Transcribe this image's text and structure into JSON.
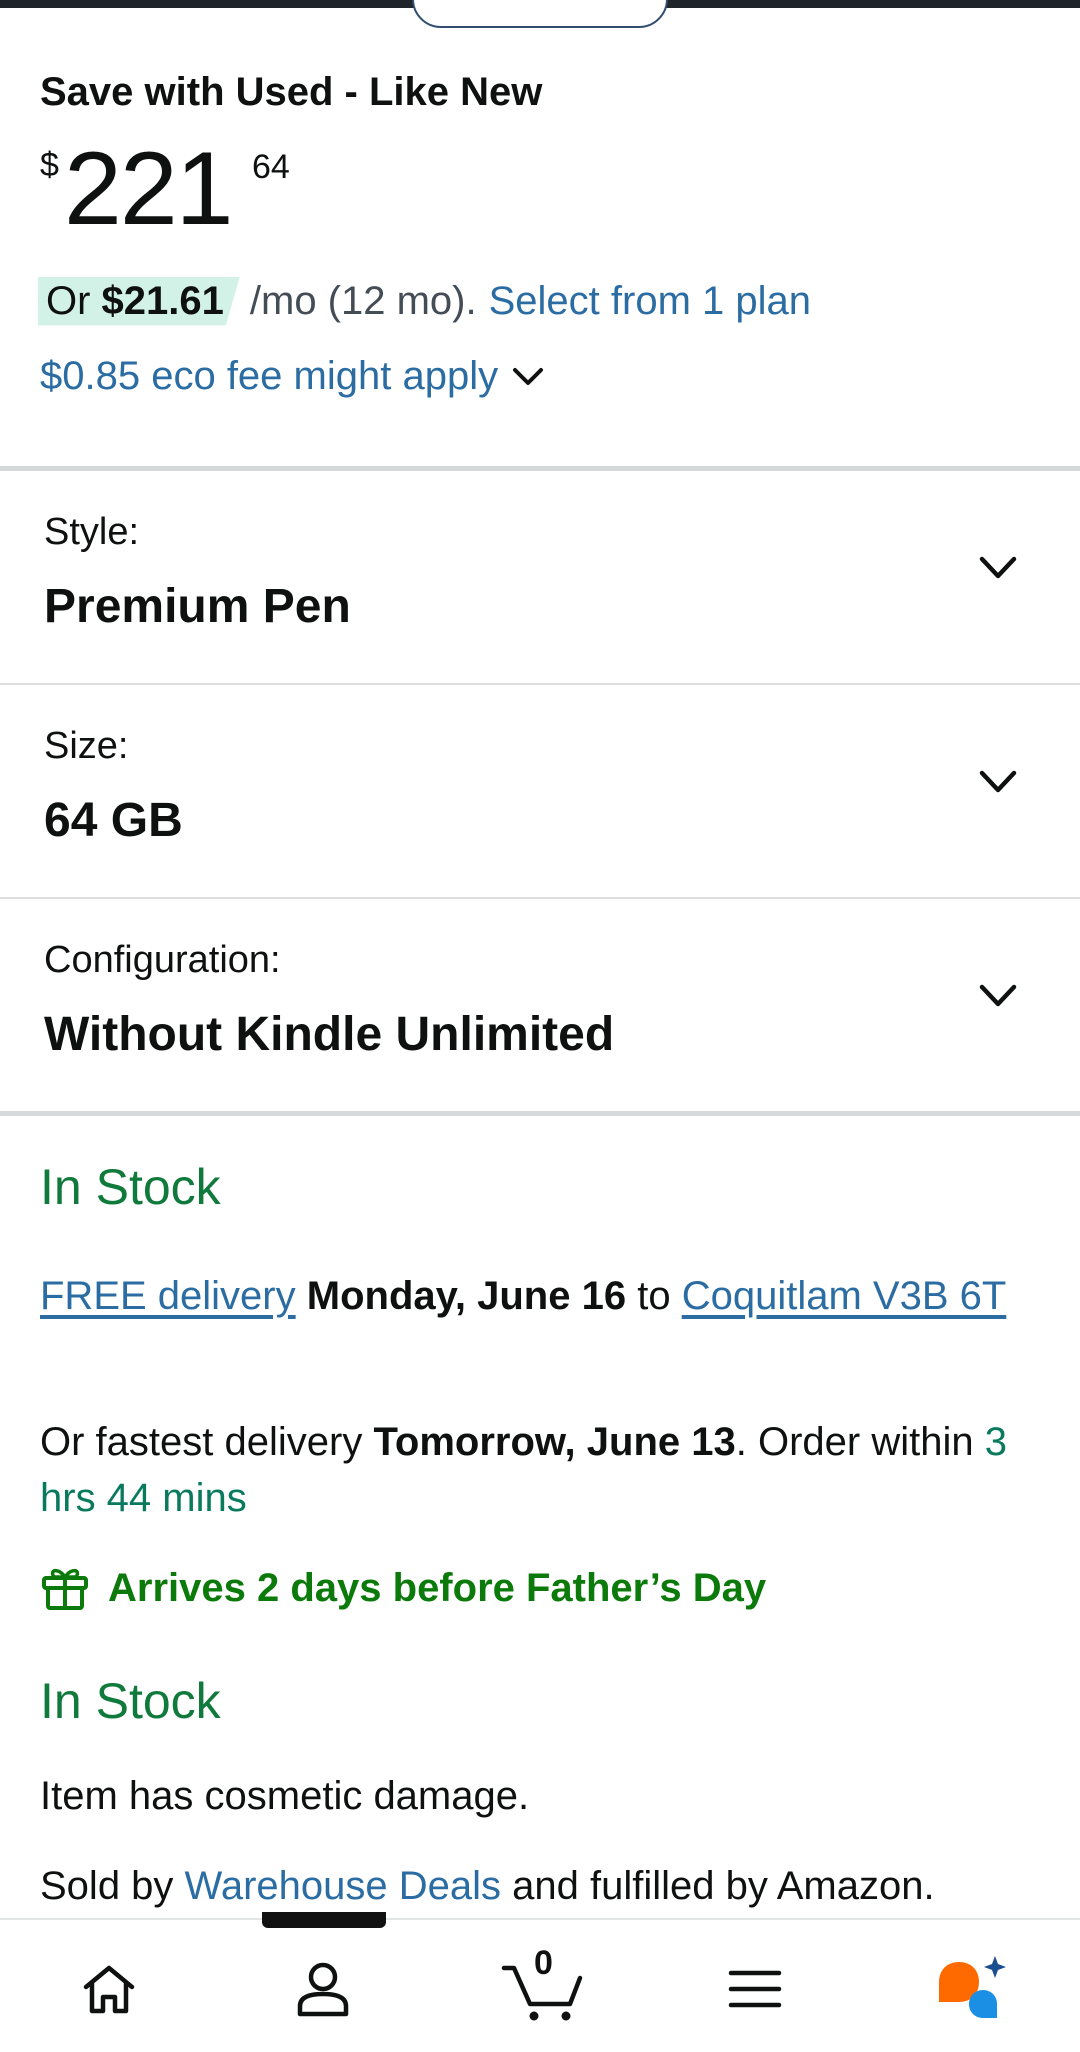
{
  "offer": {
    "title": "Save with Used - Like New",
    "price_currency": "$",
    "price_whole": "221",
    "price_fraction": "64"
  },
  "installment": {
    "prefix": "Or ",
    "amount": "$21.61",
    "term": "/mo (12 mo).",
    "plan_link": "Select from 1 plan"
  },
  "eco_fee": {
    "label": "$0.85 eco fee might apply"
  },
  "options": [
    {
      "label": "Style:",
      "value": "Premium Pen"
    },
    {
      "label": "Size:",
      "value": "64 GB"
    },
    {
      "label": "Configuration:",
      "value": "Without Kindle Unlimited"
    }
  ],
  "availability": {
    "stock_1": "In Stock",
    "free_delivery_link": "FREE delivery",
    "delivery_date": "Monday, June 16",
    "to_word": "to",
    "location_link": "Coquitlam V3B 6T",
    "fastest_prefix": "Or fastest delivery",
    "fastest_date": "Tomorrow, June 13",
    "order_within_prefix": ". Order within",
    "countdown": "3 hrs 44 mins",
    "gift_message": "Arrives 2 days before Father’s Day",
    "stock_2": "In Stock",
    "condition_note": "Item has cosmetic damage.",
    "sold_by_prefix": "Sold by",
    "seller_link": "Warehouse Deals",
    "fulfilled_suffix": "and fulfilled by Amazon."
  },
  "bottom_nav": {
    "cart_count": "0",
    "items": [
      "home-icon",
      "account-icon",
      "cart-icon",
      "menu-icon",
      "assistant-icon"
    ]
  },
  "colors": {
    "link": "#2b6da3",
    "stock_green": "#0f7a3b",
    "gift_green": "#0b7a0b",
    "installment_highlight": "#d3f2e7",
    "assistant_orange": "#ff6a00",
    "assistant_blue": "#1a8fe3"
  }
}
